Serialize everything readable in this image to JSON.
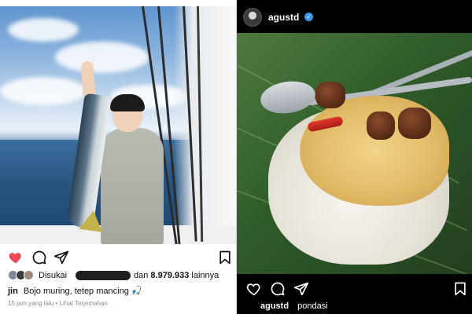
{
  "left_post": {
    "likes": {
      "label": "Disukai",
      "conjunction": "dan",
      "count": "8.979.933",
      "suffix": "lainnya"
    },
    "caption": {
      "username": "jin",
      "text": "Bojo muring, tetep mancing",
      "emoji": "🎣"
    },
    "timestamp": "15 jam yang lalu",
    "separator": "•",
    "translate_link": "Lihat Terjemahan",
    "icons": [
      "heart-icon",
      "comment-icon",
      "share-icon",
      "bookmark-icon"
    ],
    "colors": {
      "heart": "#ed4956",
      "text": "#111111",
      "meta": "#8e8e8e"
    }
  },
  "right_post": {
    "username": "agustd",
    "verified": true,
    "caption": {
      "username": "agustd",
      "text": "pondasi"
    },
    "icons": [
      "heart-icon",
      "comment-icon",
      "share-icon",
      "bookmark-icon"
    ],
    "colors": {
      "background": "#000000",
      "text": "#ffffff",
      "verified": "#3797f0"
    }
  }
}
